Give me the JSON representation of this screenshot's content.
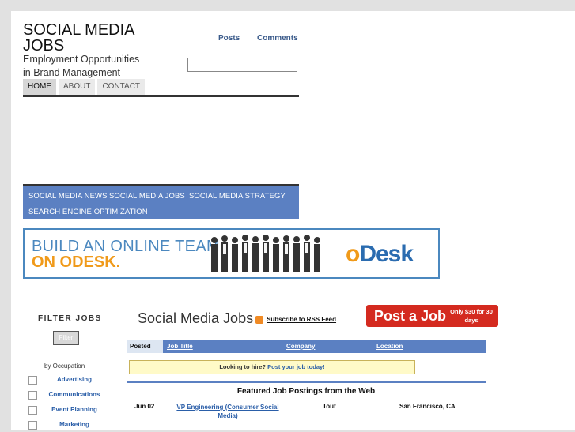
{
  "site": {
    "title": "SOCIAL MEDIA JOBS",
    "tagline": "Employment Opportunities in Brand Management"
  },
  "topnav": {
    "posts": "Posts",
    "comments": "Comments"
  },
  "search": {
    "placeholder": "",
    "value": ""
  },
  "tabs": [
    "HOME",
    "ABOUT",
    "CONTACT"
  ],
  "categories": [
    "SOCIAL MEDIA NEWS",
    "SOCIAL MEDIA JOBS",
    "SOCIAL MEDIA STRATEGY",
    "SEARCH ENGINE OPTIMIZATION"
  ],
  "banner": {
    "line1": "BUILD AN ONLINE TEAM",
    "line2": "ON ODESK.",
    "logo_o": "o",
    "logo_rest": "Desk",
    "colors": {
      "blue": "#4b88bf",
      "orange": "#f09a1a"
    }
  },
  "filter": {
    "title": "FILTER JOBS",
    "button": "Filter",
    "occupation_label": "by Occupation",
    "occupations": [
      "Advertising",
      "Communications",
      "Event Planning",
      "Marketing"
    ]
  },
  "jobs": {
    "title": "Social Media Jobs",
    "rss_label": "Subscribe to RSS Feed",
    "post_job": "Post a Job",
    "post_job_price": "Only $30 for 30 days",
    "columns": {
      "posted": "Posted",
      "title": "Job Title",
      "company": "Company",
      "location": "Location"
    },
    "hire_prompt": "Looking to hire?",
    "hire_link": "Post your job today!",
    "featured_heading": "Featured Job Postings from the Web",
    "rows": [
      {
        "date": "Jun 02",
        "title": "VP Engineering (Consumer Social Media)",
        "company": "Tout",
        "location": "San Francisco, CA"
      }
    ]
  }
}
